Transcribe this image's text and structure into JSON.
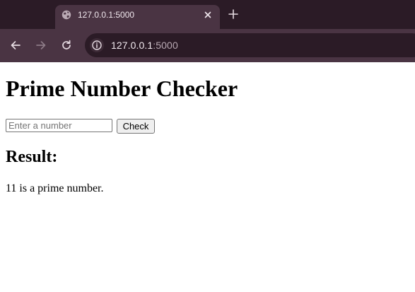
{
  "browser": {
    "tab": {
      "title": "127.0.0.1:5000",
      "favicon": "globe-icon",
      "close_icon": "close-icon"
    },
    "new_tab_icon": "plus-icon",
    "nav": {
      "back_icon": "arrow-left-icon",
      "forward_icon": "arrow-right-icon",
      "reload_icon": "reload-icon"
    },
    "omnibox": {
      "site_info_icon": "info-icon",
      "url_host": "127.0.0.1",
      "url_port": ":5000"
    },
    "colors": {
      "tabstrip_bg": "#2b1b26",
      "toolbar_bg": "#4a3443",
      "omnibox_bg": "#2b1b26"
    }
  },
  "page": {
    "heading": "Prime Number Checker",
    "input": {
      "placeholder": "Enter a number",
      "value": ""
    },
    "check_button": "Check",
    "result_heading": "Result:",
    "result_text": "11 is a prime number."
  }
}
